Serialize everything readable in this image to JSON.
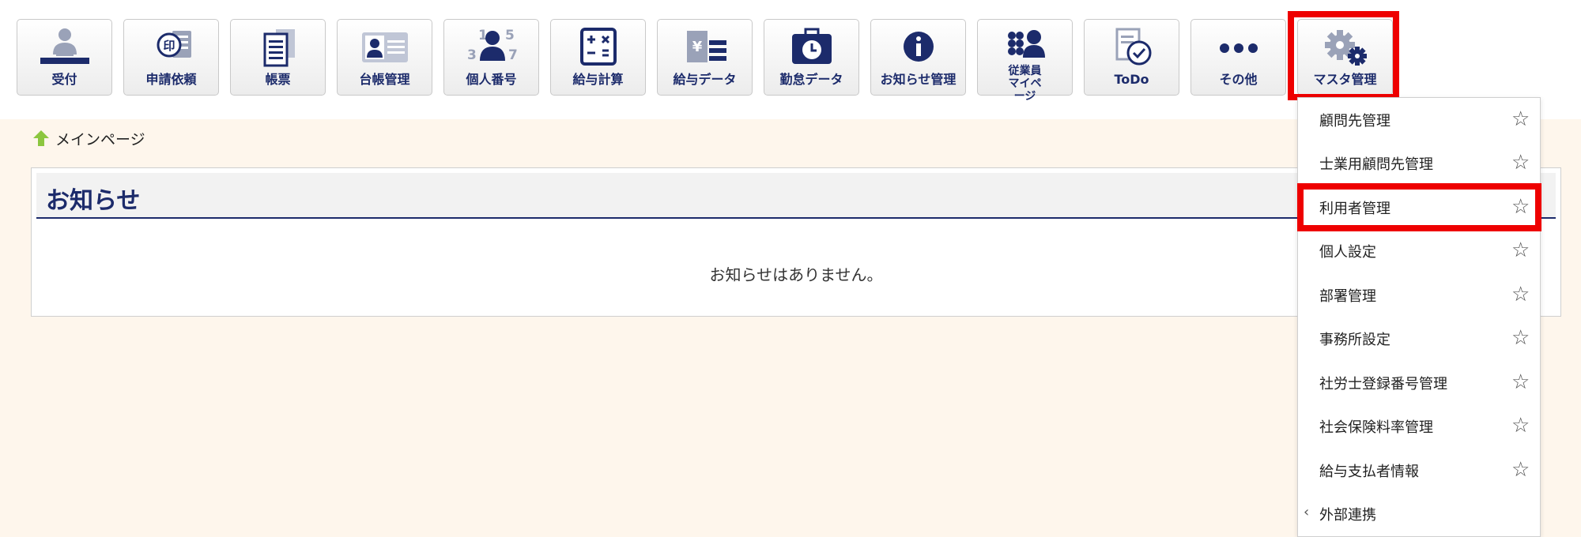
{
  "toolbar": {
    "items": [
      {
        "label": "受付",
        "icon": "reception-icon"
      },
      {
        "label": "申請依頼",
        "icon": "application-request-icon"
      },
      {
        "label": "帳票",
        "icon": "forms-icon"
      },
      {
        "label": "台帳管理",
        "icon": "ledger-icon"
      },
      {
        "label": "個人番号",
        "icon": "personal-number-icon"
      },
      {
        "label": "給与計算",
        "icon": "calculator-icon"
      },
      {
        "label": "給与データ",
        "icon": "payroll-data-icon"
      },
      {
        "label": "勤怠データ",
        "icon": "attendance-clock-icon"
      },
      {
        "label": "お知らせ管理",
        "icon": "info-icon"
      },
      {
        "label": "従業員マイページ",
        "icon": "employee-mypage-icon"
      },
      {
        "label": "ToDo",
        "icon": "todo-check-icon"
      },
      {
        "label": "その他",
        "icon": "more-dots-icon"
      },
      {
        "label": "マスタ管理",
        "icon": "gear-icon"
      }
    ]
  },
  "breadcrumb": {
    "label": "メインページ",
    "icon": "home-arrow-icon"
  },
  "notice_panel": {
    "title": "お知らせ",
    "empty_message": "お知らせはありません。"
  },
  "master_menu": {
    "items": [
      {
        "label": "顧問先管理"
      },
      {
        "label": "士業用顧問先管理"
      },
      {
        "label": "利用者管理"
      },
      {
        "label": "個人設定"
      },
      {
        "label": "部署管理"
      },
      {
        "label": "事務所設定"
      },
      {
        "label": "社労士登録番号管理"
      },
      {
        "label": "社会保険料率管理"
      },
      {
        "label": "給与支払者情報"
      }
    ],
    "star_glyph": "☆",
    "external": {
      "label": "外部連携",
      "chevron": "‹"
    }
  },
  "colors": {
    "navy": "#1c2b6b",
    "highlight": "#ee0000",
    "background": "#fef6ec"
  }
}
